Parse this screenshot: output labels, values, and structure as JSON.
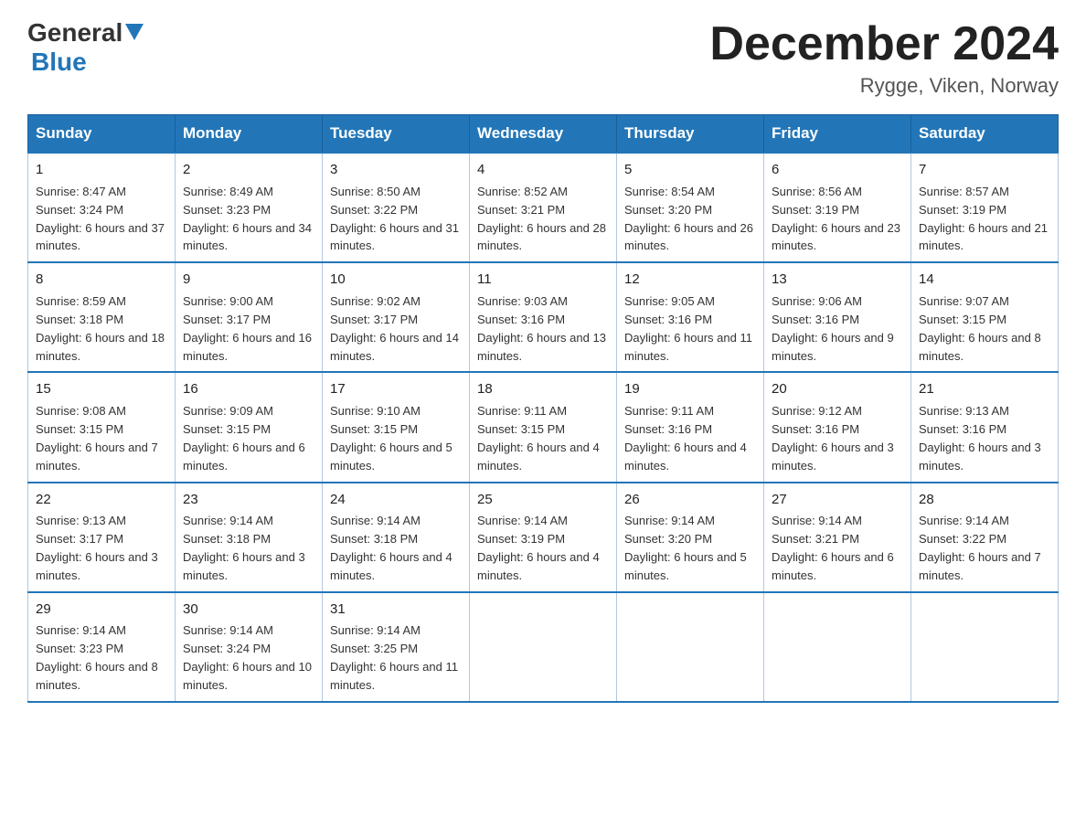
{
  "header": {
    "logo_general": "General",
    "logo_blue": "Blue",
    "month_title": "December 2024",
    "location": "Rygge, Viken, Norway"
  },
  "days_of_week": [
    "Sunday",
    "Monday",
    "Tuesday",
    "Wednesday",
    "Thursday",
    "Friday",
    "Saturday"
  ],
  "weeks": [
    [
      {
        "day": "1",
        "sunrise": "8:47 AM",
        "sunset": "3:24 PM",
        "daylight": "6 hours and 37 minutes."
      },
      {
        "day": "2",
        "sunrise": "8:49 AM",
        "sunset": "3:23 PM",
        "daylight": "6 hours and 34 minutes."
      },
      {
        "day": "3",
        "sunrise": "8:50 AM",
        "sunset": "3:22 PM",
        "daylight": "6 hours and 31 minutes."
      },
      {
        "day": "4",
        "sunrise": "8:52 AM",
        "sunset": "3:21 PM",
        "daylight": "6 hours and 28 minutes."
      },
      {
        "day": "5",
        "sunrise": "8:54 AM",
        "sunset": "3:20 PM",
        "daylight": "6 hours and 26 minutes."
      },
      {
        "day": "6",
        "sunrise": "8:56 AM",
        "sunset": "3:19 PM",
        "daylight": "6 hours and 23 minutes."
      },
      {
        "day": "7",
        "sunrise": "8:57 AM",
        "sunset": "3:19 PM",
        "daylight": "6 hours and 21 minutes."
      }
    ],
    [
      {
        "day": "8",
        "sunrise": "8:59 AM",
        "sunset": "3:18 PM",
        "daylight": "6 hours and 18 minutes."
      },
      {
        "day": "9",
        "sunrise": "9:00 AM",
        "sunset": "3:17 PM",
        "daylight": "6 hours and 16 minutes."
      },
      {
        "day": "10",
        "sunrise": "9:02 AM",
        "sunset": "3:17 PM",
        "daylight": "6 hours and 14 minutes."
      },
      {
        "day": "11",
        "sunrise": "9:03 AM",
        "sunset": "3:16 PM",
        "daylight": "6 hours and 13 minutes."
      },
      {
        "day": "12",
        "sunrise": "9:05 AM",
        "sunset": "3:16 PM",
        "daylight": "6 hours and 11 minutes."
      },
      {
        "day": "13",
        "sunrise": "9:06 AM",
        "sunset": "3:16 PM",
        "daylight": "6 hours and 9 minutes."
      },
      {
        "day": "14",
        "sunrise": "9:07 AM",
        "sunset": "3:15 PM",
        "daylight": "6 hours and 8 minutes."
      }
    ],
    [
      {
        "day": "15",
        "sunrise": "9:08 AM",
        "sunset": "3:15 PM",
        "daylight": "6 hours and 7 minutes."
      },
      {
        "day": "16",
        "sunrise": "9:09 AM",
        "sunset": "3:15 PM",
        "daylight": "6 hours and 6 minutes."
      },
      {
        "day": "17",
        "sunrise": "9:10 AM",
        "sunset": "3:15 PM",
        "daylight": "6 hours and 5 minutes."
      },
      {
        "day": "18",
        "sunrise": "9:11 AM",
        "sunset": "3:15 PM",
        "daylight": "6 hours and 4 minutes."
      },
      {
        "day": "19",
        "sunrise": "9:11 AM",
        "sunset": "3:16 PM",
        "daylight": "6 hours and 4 minutes."
      },
      {
        "day": "20",
        "sunrise": "9:12 AM",
        "sunset": "3:16 PM",
        "daylight": "6 hours and 3 minutes."
      },
      {
        "day": "21",
        "sunrise": "9:13 AM",
        "sunset": "3:16 PM",
        "daylight": "6 hours and 3 minutes."
      }
    ],
    [
      {
        "day": "22",
        "sunrise": "9:13 AM",
        "sunset": "3:17 PM",
        "daylight": "6 hours and 3 minutes."
      },
      {
        "day": "23",
        "sunrise": "9:14 AM",
        "sunset": "3:18 PM",
        "daylight": "6 hours and 3 minutes."
      },
      {
        "day": "24",
        "sunrise": "9:14 AM",
        "sunset": "3:18 PM",
        "daylight": "6 hours and 4 minutes."
      },
      {
        "day": "25",
        "sunrise": "9:14 AM",
        "sunset": "3:19 PM",
        "daylight": "6 hours and 4 minutes."
      },
      {
        "day": "26",
        "sunrise": "9:14 AM",
        "sunset": "3:20 PM",
        "daylight": "6 hours and 5 minutes."
      },
      {
        "day": "27",
        "sunrise": "9:14 AM",
        "sunset": "3:21 PM",
        "daylight": "6 hours and 6 minutes."
      },
      {
        "day": "28",
        "sunrise": "9:14 AM",
        "sunset": "3:22 PM",
        "daylight": "6 hours and 7 minutes."
      }
    ],
    [
      {
        "day": "29",
        "sunrise": "9:14 AM",
        "sunset": "3:23 PM",
        "daylight": "6 hours and 8 minutes."
      },
      {
        "day": "30",
        "sunrise": "9:14 AM",
        "sunset": "3:24 PM",
        "daylight": "6 hours and 10 minutes."
      },
      {
        "day": "31",
        "sunrise": "9:14 AM",
        "sunset": "3:25 PM",
        "daylight": "6 hours and 11 minutes."
      },
      null,
      null,
      null,
      null
    ]
  ],
  "labels": {
    "sunrise_prefix": "Sunrise: ",
    "sunset_prefix": "Sunset: ",
    "daylight_prefix": "Daylight: "
  }
}
